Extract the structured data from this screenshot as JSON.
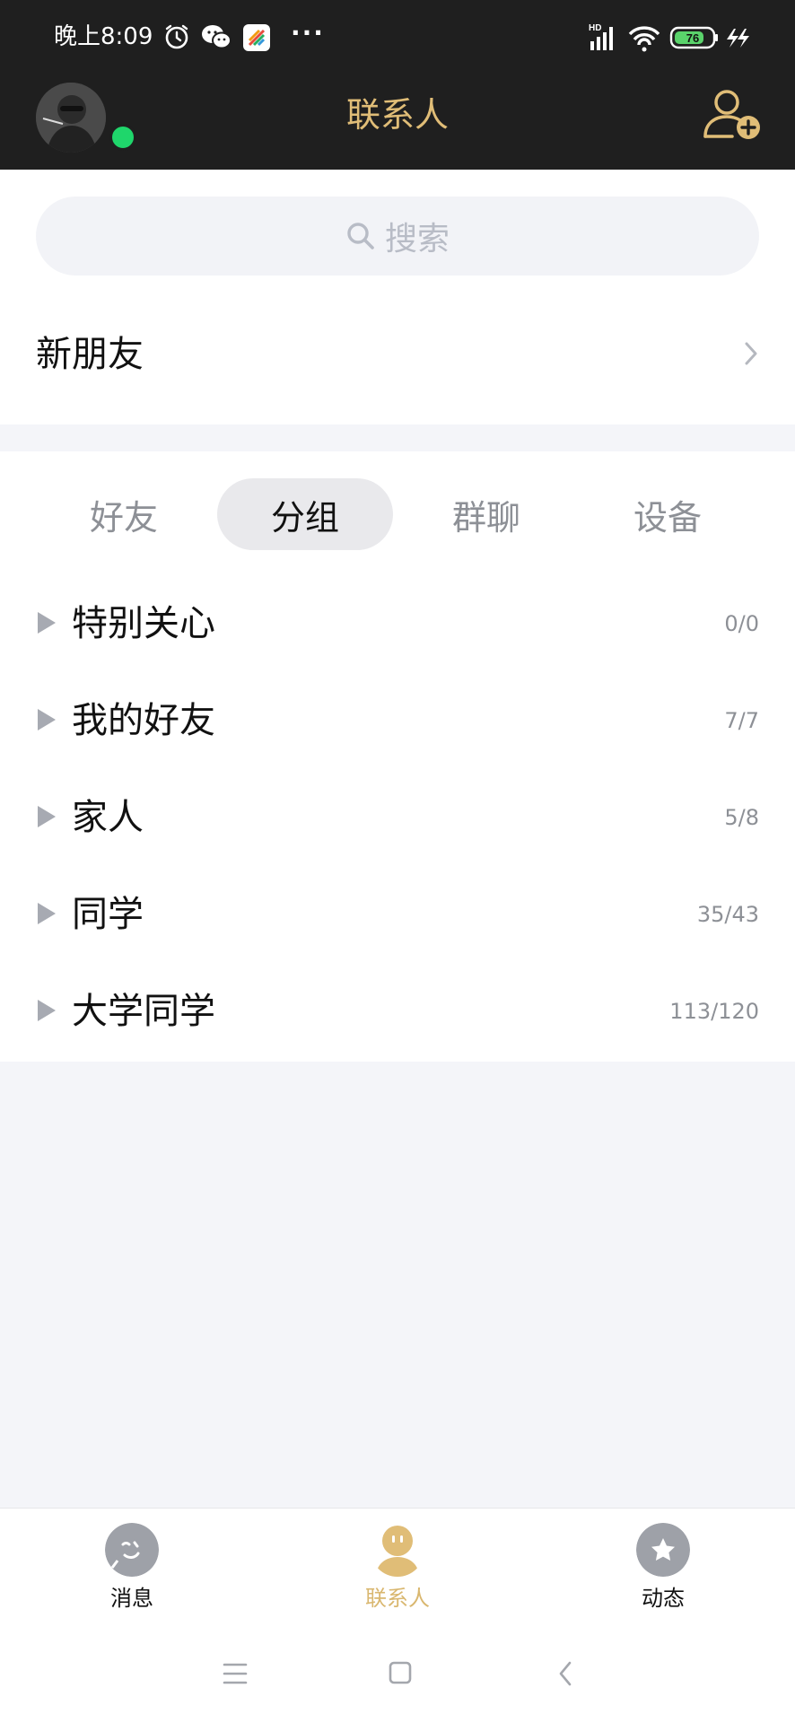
{
  "status_bar": {
    "time": "晚上8:09",
    "network": "HD",
    "battery": "76",
    "icons": [
      "alarm-icon",
      "wechat-icon",
      "app-icon",
      "more-dots-icon",
      "signal-icon",
      "wifi-icon",
      "battery-icon",
      "charging-icon"
    ]
  },
  "header": {
    "title": "联系人",
    "online_status_color": "#1fd66b",
    "accent_color": "#e0bd77",
    "right_icon": "add-contact-icon"
  },
  "search": {
    "placeholder": "搜索",
    "icon": "search-icon"
  },
  "new_friends": {
    "label": "新朋友"
  },
  "tabs": [
    {
      "label": "好友",
      "active": false
    },
    {
      "label": "分组",
      "active": true
    },
    {
      "label": "群聊",
      "active": false
    },
    {
      "label": "设备",
      "active": false
    }
  ],
  "groups": [
    {
      "name": "特别关心",
      "count": "0/0"
    },
    {
      "name": "我的好友",
      "count": "7/7"
    },
    {
      "name": "家人",
      "count": "5/8"
    },
    {
      "name": "同学",
      "count": "35/43"
    },
    {
      "name": "大学同学",
      "count": "113/120"
    }
  ],
  "bottom_nav": [
    {
      "label": "消息",
      "icon": "message-icon",
      "active": false
    },
    {
      "label": "联系人",
      "icon": "contacts-icon",
      "active": true
    },
    {
      "label": "动态",
      "icon": "star-icon",
      "active": false
    }
  ],
  "system_nav": [
    "menu-icon",
    "home-icon",
    "back-icon"
  ]
}
